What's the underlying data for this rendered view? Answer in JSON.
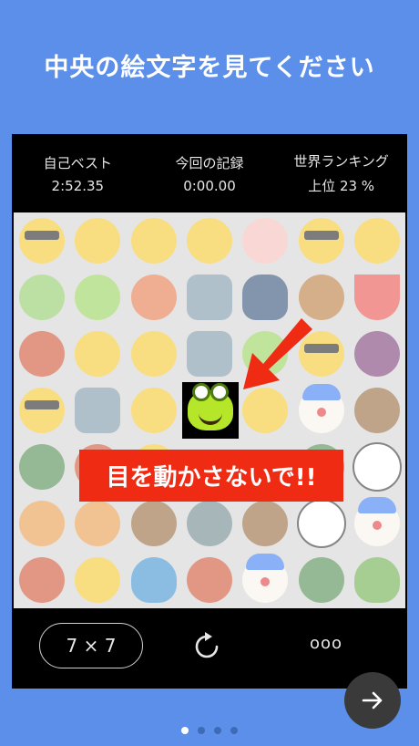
{
  "header": {
    "title": "中央の絵文字を見てください"
  },
  "stats": [
    {
      "label": "自己ベスト",
      "value": "2:52.35"
    },
    {
      "label": "今回の記録",
      "value": "0:00.00"
    },
    {
      "label": "世界ランキング",
      "value": "上位 23 %"
    }
  ],
  "board": {
    "center_emoji": "frog-face",
    "warning": "目を動かさないで!!",
    "grid_icons": [
      "sunglasses-face-icon",
      "hatching-chick-icon",
      "screaming-face-icon",
      "screaming-face-icon",
      "pig-face-icon",
      "sunglasses-face-icon",
      "hatching-chick-icon",
      "melon-icon",
      "frog-face-icon",
      "octopus-icon",
      "robot-face-icon",
      "penguin-icon",
      "bear-face-icon",
      "watermelon-icon",
      "devil-face-icon",
      "winking-kiss-face-icon",
      "dizzy-face-icon",
      "robot-face-icon",
      "frog-face-icon",
      "sunglasses-face-icon",
      "grapes-icon",
      "sunglasses-face-icon",
      "robot-face-icon",
      "kiss-face-icon",
      "frog-center-icon",
      "grinning-face-icon",
      "clown-face-icon",
      "monkey-face-icon",
      "dragon-face-icon",
      "devil-face-icon",
      "dizzy-face-icon",
      "banner-covered",
      "banner-covered",
      "dragon-face-icon",
      "panda-face-icon",
      "cat-face-icon",
      "cat-face-icon",
      "monkey-face-icon",
      "alien-face-icon",
      "monkey-face-icon",
      "panda-face-icon",
      "clown-face-icon",
      "devil-face-icon",
      "dizzy-face-icon",
      "whale-icon",
      "devil-face-icon",
      "clown-face-icon",
      "dragon-face-icon",
      "green-blob-face-icon"
    ]
  },
  "toolbar": {
    "size_label": "7 × 7",
    "more_label": "ooo"
  },
  "pagination": {
    "count": 4,
    "active": 0
  }
}
